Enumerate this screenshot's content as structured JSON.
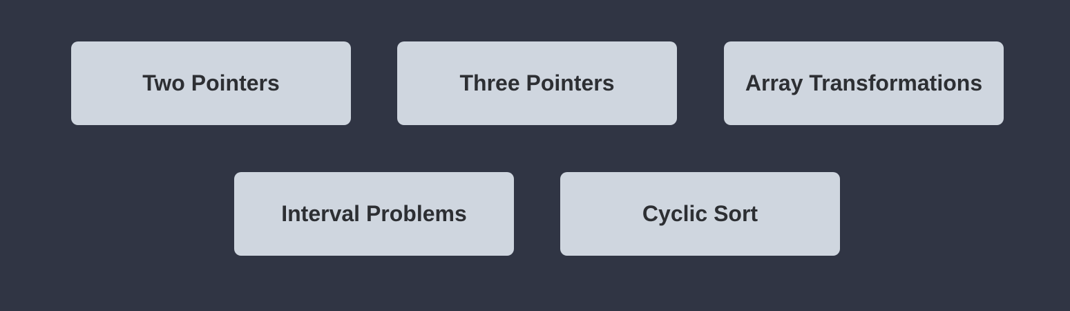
{
  "topics": [
    {
      "label": "Two Pointers"
    },
    {
      "label": "Three Pointers"
    },
    {
      "label": "Array Transformations"
    },
    {
      "label": "Interval Problems"
    },
    {
      "label": "Cyclic Sort"
    }
  ],
  "colors": {
    "background": "#303544",
    "card": "#cfd6df",
    "text": "#2d2f33"
  }
}
